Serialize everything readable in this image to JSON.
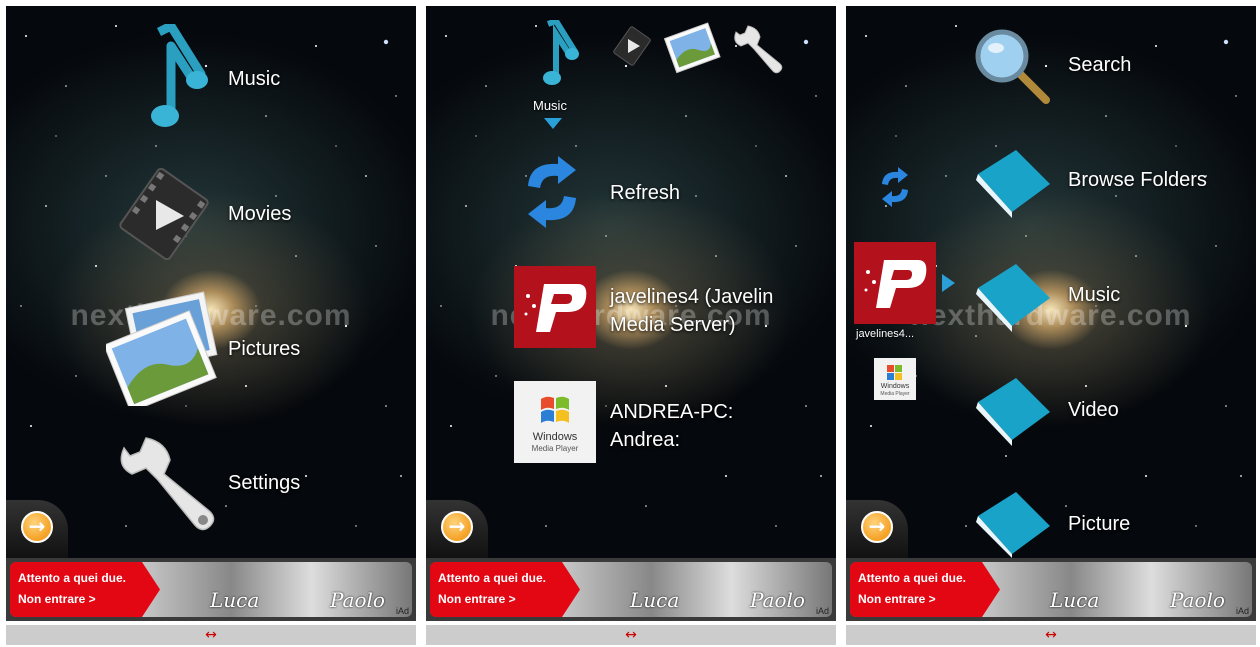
{
  "watermark": "nexthardware.com",
  "panel1": {
    "menu": [
      {
        "label": "Music",
        "icon": "music-note-icon"
      },
      {
        "label": "Movies",
        "icon": "film-icon"
      },
      {
        "label": "Pictures",
        "icon": "photos-icon"
      },
      {
        "label": "Settings",
        "icon": "wrench-icon"
      }
    ]
  },
  "panel2": {
    "crumb_label": "Music",
    "items": [
      {
        "label": "Refresh",
        "icon": "refresh-icon"
      },
      {
        "label_line1": "javelines4 (Javelin",
        "label_line2": "Media Server)",
        "icon": "javelin-icon"
      },
      {
        "label_line1": "ANDREA-PC:",
        "label_line2": "Andrea:",
        "icon": "windows-media-player-icon"
      }
    ],
    "wmp_text1": "Windows",
    "wmp_text2": "Media Player"
  },
  "panel3": {
    "server_label": "javelines4...",
    "wmp_text1": "Windows",
    "wmp_text2": "Media Player",
    "items": [
      {
        "label": "Search",
        "icon": "magnifier-icon"
      },
      {
        "label": "Browse Folders",
        "icon": "folder-icon"
      },
      {
        "label": "Music",
        "icon": "folder-icon"
      },
      {
        "label": "Video",
        "icon": "folder-icon"
      },
      {
        "label": "Picture",
        "icon": "folder-icon"
      }
    ]
  },
  "ad": {
    "line1": "Attento a quei due.",
    "line2": "Non entrare >",
    "name1": "Luca",
    "name2": "Paolo",
    "badge": "iAd"
  },
  "resize_symbol": "↔",
  "next_symbol": "→",
  "colors": {
    "accent": "#2a9fc0",
    "ad_red": "#e30613",
    "folder": "#1aa3c8",
    "resize": "#cc0000"
  }
}
